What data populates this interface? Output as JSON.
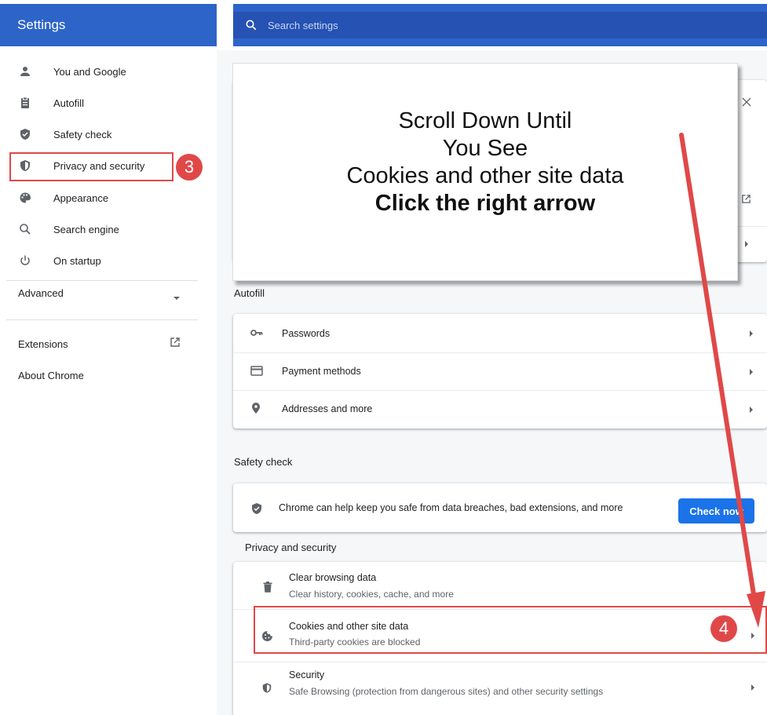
{
  "header": {
    "title": "Settings",
    "search_placeholder": "Search settings"
  },
  "sidebar": {
    "items": [
      {
        "label": "You and Google",
        "icon": "person-icon"
      },
      {
        "label": "Autofill",
        "icon": "clipboard-icon"
      },
      {
        "label": "Safety check",
        "icon": "shield-check-icon"
      },
      {
        "label": "Privacy and security",
        "icon": "shield-half-icon"
      },
      {
        "label": "Appearance",
        "icon": "palette-icon"
      },
      {
        "label": "Search engine",
        "icon": "search-icon"
      },
      {
        "label": "On startup",
        "icon": "power-icon"
      }
    ],
    "advanced": "Advanced",
    "extensions": "Extensions",
    "about": "About Chrome"
  },
  "main": {
    "autofill": {
      "title": "Autofill",
      "rows": [
        "Passwords",
        "Payment methods",
        "Addresses and more"
      ]
    },
    "safety": {
      "title": "Safety check",
      "text": "Chrome can help keep you safe from data breaches, bad extensions, and more",
      "button": "Check now"
    },
    "privacy": {
      "title": "Privacy and security",
      "rows": [
        {
          "label": "Clear browsing data",
          "sub": "Clear history, cookies, cache, and more"
        },
        {
          "label": "Cookies and other site data",
          "sub": "Third-party cookies are blocked"
        },
        {
          "label": "Security",
          "sub": "Safe Browsing (protection from dangerous sites) and other security settings"
        }
      ]
    }
  },
  "overlay": {
    "line1": "Scroll Down Until",
    "line2": "You See",
    "line3": "Cookies and other site data",
    "line4": "Click the right arrow"
  },
  "steps": {
    "step3": "3",
    "step4": "4"
  },
  "colors": {
    "accent": "#2d64c8",
    "annotation": "#e04848",
    "button": "#1a73e8"
  }
}
